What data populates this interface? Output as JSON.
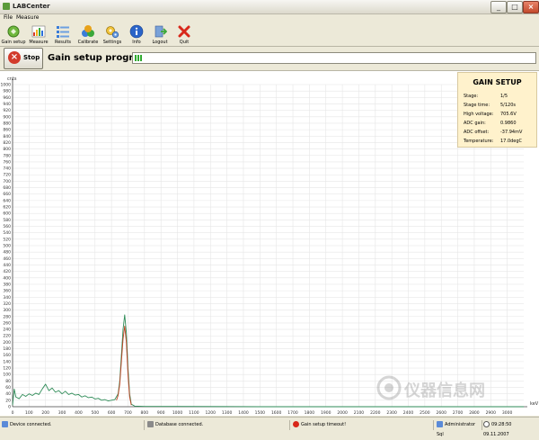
{
  "window": {
    "title": "LABCenter",
    "min": "_",
    "max": "□",
    "close": "×"
  },
  "menu": {
    "file": "File",
    "measure": "Measure"
  },
  "toolbar": {
    "gain_setup": "Gain setup",
    "measure": "Measure",
    "results": "Results",
    "calibrate": "Calibrate",
    "settings": "Settings",
    "info": "Info",
    "logout": "Logout",
    "quit": "Quit"
  },
  "progress": {
    "stop_label": "Stop",
    "label": "Gain setup progress:",
    "fraction": 0.025
  },
  "gain_setup": {
    "title": "GAIN SETUP",
    "rows": [
      {
        "label": "Stage:",
        "value": "1/5"
      },
      {
        "label": "Stage time:",
        "value": "5/120s"
      },
      {
        "label": "High voltage:",
        "value": "705.6V"
      },
      {
        "label": "ADC gain:",
        "value": "0.9860"
      },
      {
        "label": "ADC offset:",
        "value": "-37.94mV"
      },
      {
        "label": "Temperature:",
        "value": "17.0degC"
      }
    ]
  },
  "status": {
    "device": "Device connected.",
    "database": "Database connected.",
    "warning": "Gain setup timeout!",
    "user": "Administrator Sql",
    "datetime": "09:28:50 09.11.2007"
  },
  "watermark": "仪器信息网",
  "chart_data": {
    "type": "line",
    "ylabel": "cnts",
    "xlabel": "keV",
    "ylim": [
      0,
      1000
    ],
    "xlim": [
      0,
      3100
    ],
    "yticks": [
      0,
      20,
      40,
      60,
      80,
      100,
      120,
      140,
      160,
      180,
      200,
      220,
      240,
      260,
      280,
      300,
      320,
      340,
      360,
      380,
      400,
      420,
      440,
      460,
      480,
      500,
      520,
      540,
      560,
      580,
      600,
      620,
      640,
      660,
      680,
      700,
      720,
      740,
      760,
      780,
      800,
      820,
      840,
      860,
      880,
      900,
      920,
      940,
      960,
      980,
      1000
    ],
    "xticks": [
      0,
      100,
      200,
      300,
      400,
      500,
      600,
      700,
      800,
      900,
      1000,
      1100,
      1200,
      1300,
      1400,
      1500,
      1600,
      1700,
      1800,
      1900,
      2000,
      2100,
      2200,
      2300,
      2400,
      2500,
      2600,
      2700,
      2800,
      2900,
      3000
    ],
    "grid": true,
    "series": [
      {
        "color": "#2e8b57",
        "points": [
          [
            0,
            5
          ],
          [
            10,
            55
          ],
          [
            20,
            30
          ],
          [
            40,
            25
          ],
          [
            60,
            38
          ],
          [
            80,
            32
          ],
          [
            100,
            40
          ],
          [
            120,
            35
          ],
          [
            140,
            42
          ],
          [
            160,
            38
          ],
          [
            180,
            55
          ],
          [
            200,
            70
          ],
          [
            220,
            50
          ],
          [
            240,
            58
          ],
          [
            260,
            45
          ],
          [
            280,
            50
          ],
          [
            300,
            40
          ],
          [
            320,
            48
          ],
          [
            340,
            38
          ],
          [
            360,
            42
          ],
          [
            380,
            36
          ],
          [
            400,
            38
          ],
          [
            420,
            30
          ],
          [
            440,
            34
          ],
          [
            460,
            28
          ],
          [
            480,
            30
          ],
          [
            500,
            24
          ],
          [
            520,
            26
          ],
          [
            540,
            20
          ],
          [
            560,
            22
          ],
          [
            580,
            18
          ],
          [
            600,
            20
          ],
          [
            620,
            22
          ],
          [
            640,
            40
          ],
          [
            650,
            80
          ],
          [
            660,
            160
          ],
          [
            670,
            240
          ],
          [
            680,
            285
          ],
          [
            690,
            230
          ],
          [
            700,
            120
          ],
          [
            710,
            40
          ],
          [
            720,
            8
          ],
          [
            740,
            2
          ],
          [
            800,
            1
          ],
          [
            1000,
            1
          ],
          [
            1500,
            0
          ],
          [
            2000,
            0
          ],
          [
            2500,
            0
          ],
          [
            3100,
            0
          ]
        ]
      },
      {
        "color": "#c04020",
        "points": [
          [
            630,
            20
          ],
          [
            640,
            35
          ],
          [
            650,
            70
          ],
          [
            660,
            140
          ],
          [
            670,
            210
          ],
          [
            680,
            250
          ],
          [
            690,
            200
          ],
          [
            700,
            100
          ],
          [
            710,
            30
          ],
          [
            720,
            5
          ]
        ]
      }
    ]
  }
}
